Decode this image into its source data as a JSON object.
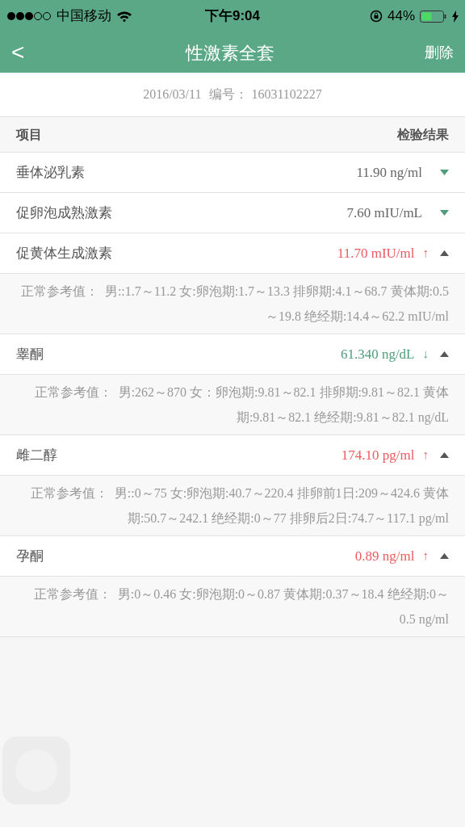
{
  "status_bar": {
    "carrier": "中国移动",
    "time": "下午9:04",
    "battery_percent": "44%"
  },
  "nav": {
    "back": "<",
    "title": "性激素全套",
    "action": "删除"
  },
  "report": {
    "date": "2016/03/11",
    "number_label": "编号：",
    "number": "16031102227"
  },
  "table": {
    "columns": [
      "项目",
      "检验结果"
    ],
    "rows": [
      {
        "name": "垂体泌乳素",
        "value": "11.90 ng/ml",
        "color": "#666666",
        "expanded": false
      },
      {
        "name": "促卵泡成熟激素",
        "value": "7.60 mIU/mL",
        "color": "#666666",
        "expanded": false
      },
      {
        "name": "促黄体生成激素",
        "value": "11.70 mIU/ml",
        "color": "#ee5b5f",
        "flag": "↑",
        "expanded": true,
        "reference_label": "正常参考值：",
        "reference": "男::1.7～11.2 女:卵泡期:1.7～13.3 排卵期:4.1～68.7 黄体期:0.5～19.8 绝经期:14.4～62.2 mIU/ml"
      },
      {
        "name": "睾酮",
        "value": "61.340 ng/dL",
        "color": "#4f9d7c",
        "flag": "↓",
        "expanded": true,
        "reference_label": "正常参考值：",
        "reference": "男:262～870 女：卵泡期:9.81～82.1 排卵期:9.81～82.1 黄体期:9.81～82.1 绝经期:9.81～82.1 ng/dL"
      },
      {
        "name": "雌二醇",
        "value": "174.10 pg/ml",
        "color": "#ee5b5f",
        "flag": "↑",
        "expanded": true,
        "reference_label": "正常参考值：",
        "reference": "男::0～75 女:卵泡期:40.7～220.4 排卵前1日:209～424.6 黄体期:50.7～242.1 绝经期:0～77 排卵后2日:74.7～117.1 pg/ml"
      },
      {
        "name": "孕酮",
        "value": "0.89 ng/ml",
        "color": "#ee5b5f",
        "flag": "↑",
        "expanded": true,
        "reference_label": "正常参考值：",
        "reference": "男:0～0.46 女:卵泡期:0～0.87 黄体期:0.37～18.4 绝经期:0～0.5 ng/ml"
      }
    ]
  }
}
